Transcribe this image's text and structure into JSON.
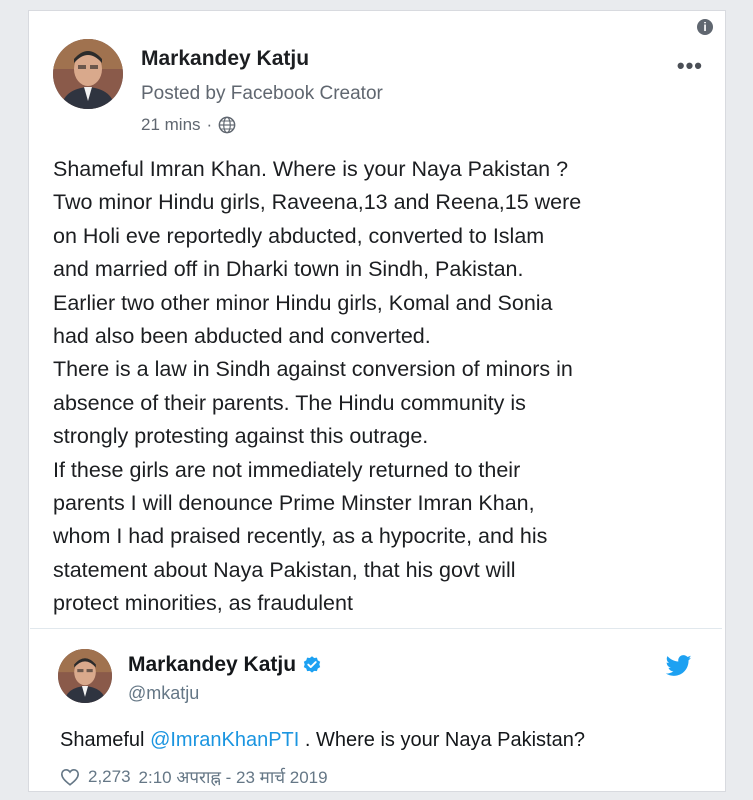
{
  "facebook_post": {
    "author_name": "Markandey Katju",
    "posted_by": "Posted by Facebook Creator",
    "timestamp": "21 mins",
    "meta_separator": "·",
    "privacy_icon": "globe-icon",
    "info_icon": "info-icon",
    "info_glyph": "i",
    "more_icon": "more-options-icon",
    "more_glyph": "•••",
    "body_lines": [
      "Shameful Imran Khan. Where is your Naya Pakistan ?",
      "Two minor Hindu girls, Raveena,13 and Reena,15 were",
      "on Holi eve reportedly abducted, converted to Islam",
      "and married off in Dharki town in Sindh, Pakistan.",
      "Earlier two other minor Hindu girls, Komal and Sonia",
      "had also been abducted and converted.",
      "There is a law in Sindh against conversion of minors in",
      "absence of their parents. The Hindu community is",
      "strongly protesting against this outrage.",
      "If these girls are not immediately returned to their",
      "parents I will denounce Prime Minster Imran Khan,",
      "whom I had praised recently, as a hypocrite, and his",
      "statement about Naya Pakistan, that his govt will",
      "protect minorities, as fraudulent"
    ]
  },
  "tweet": {
    "author_name": "Markandey Katju",
    "handle": "@mkatju",
    "verified_icon": "verified-badge-icon",
    "bird_icon": "twitter-bird-icon",
    "text_prefix": "Shameful ",
    "mention": "@ImranKhanPTI",
    "text_suffix": " . Where is your Naya Pakistan?",
    "like_count": "2,273",
    "timestamp": "2:10 अपराह्न - 23 मार्च 2019"
  },
  "colors": {
    "twitter_blue": "#1da1f2",
    "mention_blue": "#1b95e0",
    "facebook_gray": "#606770"
  }
}
